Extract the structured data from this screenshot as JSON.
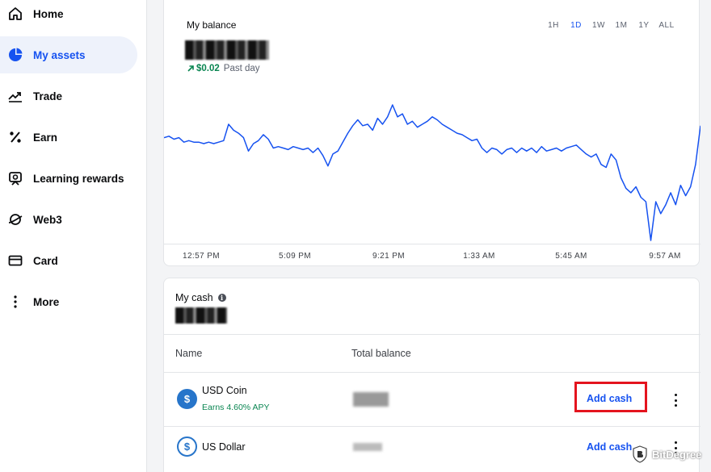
{
  "sidebar": {
    "items": [
      {
        "label": "Home",
        "icon": "home-icon"
      },
      {
        "label": "My assets",
        "icon": "pie-chart-icon",
        "active": true
      },
      {
        "label": "Trade",
        "icon": "trend-up-icon"
      },
      {
        "label": "Earn",
        "icon": "percent-icon"
      },
      {
        "label": "Learning rewards",
        "icon": "reward-icon"
      },
      {
        "label": "Web3",
        "icon": "planet-icon"
      },
      {
        "label": "Card",
        "icon": "card-icon"
      },
      {
        "label": "More",
        "icon": "more-vertical-icon"
      }
    ]
  },
  "balance": {
    "title": "My balance",
    "change_value": "$0.02",
    "change_label": "Past day",
    "ranges": [
      "1H",
      "1D",
      "1W",
      "1M",
      "1Y",
      "ALL"
    ],
    "active_range": "1D"
  },
  "chart_data": {
    "type": "line",
    "title": "",
    "xlabel": "",
    "ylabel": "",
    "x_ticks": [
      "12:57 PM",
      "5:09 PM",
      "9:21 PM",
      "1:33 AM",
      "5:45 AM",
      "9:57 AM"
    ],
    "grid": false,
    "series": [
      {
        "color": "#1652f0",
        "values": [
          55,
          56,
          54,
          55,
          52,
          53,
          52,
          52,
          51,
          52,
          51,
          52,
          53,
          64,
          60,
          58,
          55,
          46,
          51,
          53,
          57,
          54,
          48,
          49,
          48,
          47,
          49,
          48,
          47,
          48,
          45,
          48,
          43,
          36,
          44,
          46,
          52,
          58,
          63,
          67,
          63,
          64,
          60,
          68,
          64,
          69,
          77,
          69,
          71,
          64,
          66,
          62,
          64,
          66,
          69,
          67,
          64,
          62,
          60,
          58,
          57,
          55,
          53,
          54,
          48,
          45,
          48,
          47,
          44,
          47,
          48,
          45,
          48,
          46,
          48,
          45,
          49,
          46,
          47,
          48,
          46,
          48,
          49,
          50,
          47,
          44,
          42,
          44,
          37,
          35,
          44,
          40,
          28,
          21,
          18,
          22,
          15,
          12,
          -14,
          12,
          4,
          10,
          18,
          10,
          23,
          16,
          22,
          37,
          63
        ]
      }
    ]
  },
  "cash": {
    "title": "My cash",
    "col_name": "Name",
    "col_total": "Total balance",
    "rows": [
      {
        "name": "USD Coin",
        "sub": "Earns 4.60% APY",
        "action": "Add cash",
        "icon": "usdc-icon"
      },
      {
        "name": "US Dollar",
        "sub": "",
        "action": "Add cash",
        "icon": "usd-icon"
      }
    ]
  },
  "watermark": {
    "text": "BitDegree"
  }
}
